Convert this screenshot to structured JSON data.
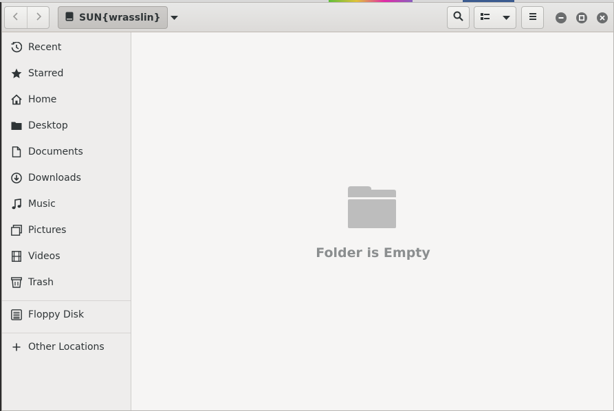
{
  "window": {
    "path_label": "SUN{wrasslin}"
  },
  "icons": {
    "back": "chevron-left-icon",
    "forward": "chevron-right-icon",
    "drive": "drive-icon",
    "path_dropdown": "caret-down-icon",
    "search": "search-icon",
    "view_list": "list-view-icon",
    "view_dropdown": "caret-down-icon",
    "menu": "hamburger-menu-icon",
    "minimize": "minimize-icon",
    "maximize": "maximize-icon",
    "close": "close-icon"
  },
  "sidebar": {
    "places": [
      {
        "label": "Recent",
        "icon": "clock-icon"
      },
      {
        "label": "Starred",
        "icon": "star-icon"
      },
      {
        "label": "Home",
        "icon": "home-icon"
      },
      {
        "label": "Desktop",
        "icon": "folder-icon"
      },
      {
        "label": "Documents",
        "icon": "document-icon"
      },
      {
        "label": "Downloads",
        "icon": "download-icon"
      },
      {
        "label": "Music",
        "icon": "music-note-icon"
      },
      {
        "label": "Pictures",
        "icon": "pictures-icon"
      },
      {
        "label": "Videos",
        "icon": "film-icon"
      },
      {
        "label": "Trash",
        "icon": "trash-icon"
      }
    ],
    "devices": [
      {
        "label": "Floppy Disk",
        "icon": "floppy-drive-icon"
      }
    ],
    "other": {
      "label": "Other Locations",
      "icon": "plus-icon"
    }
  },
  "main": {
    "empty_label": "Folder is Empty",
    "empty_icon": "empty-folder-icon"
  },
  "colors": {
    "accent_folder": "#bdbdbd",
    "empty_text": "#8b8e8f"
  }
}
